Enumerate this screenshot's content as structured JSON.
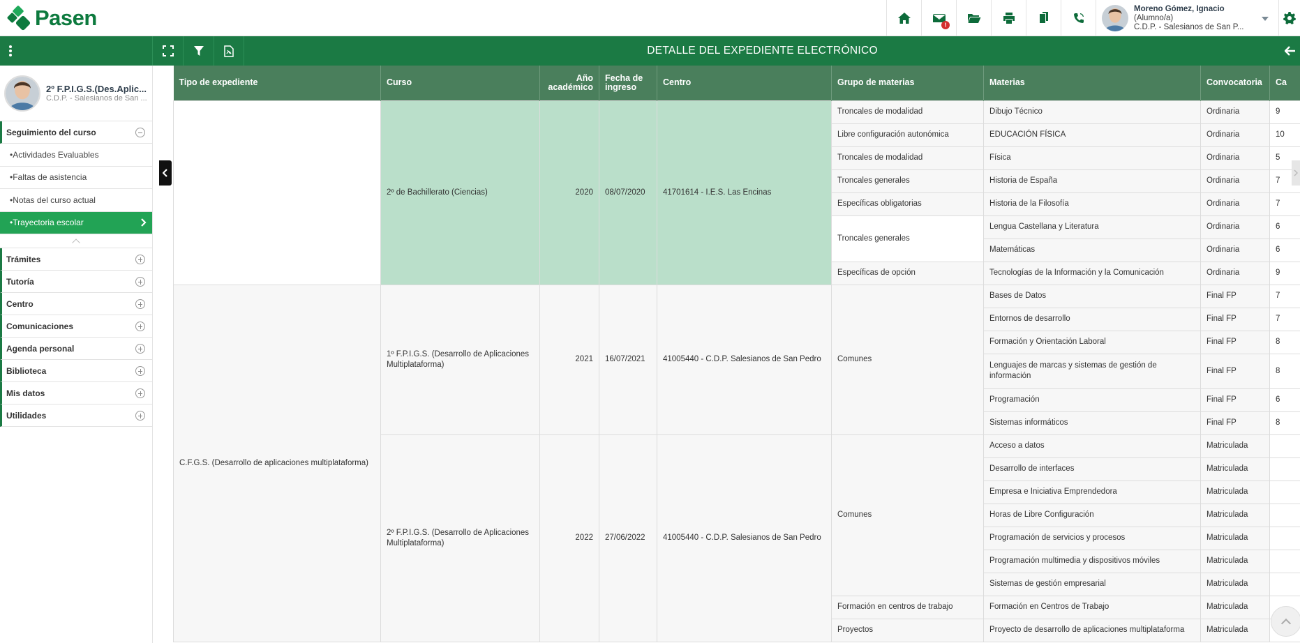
{
  "app": {
    "name": "Pasen"
  },
  "user": {
    "name": "Moreno Gómez, Ignacio",
    "role": "(Alumno/a)",
    "school": "C.D.P. - Salesianos de San P..."
  },
  "toolbar": {
    "icons": [
      "home-icon",
      "mail-icon",
      "folder-open-icon",
      "print-icon",
      "copy-icon",
      "phone-icon"
    ],
    "mail_badge": "!"
  },
  "greenbar": {
    "title": "DETALLE DEL EXPEDIENTE ELECTRÓNICO"
  },
  "profile": {
    "title": "2º F.P.I.G.S.(Des.Aplic...",
    "subtitle": "C.D.P. - Salesianos de San ..."
  },
  "sidebar": {
    "section_open": "Seguimiento del curso",
    "sub_items": [
      "•Actividades Evaluables",
      "•Faltas de asistencia",
      "•Notas del curso actual",
      "•Trayectoria escolar"
    ],
    "sections": [
      "Trámites",
      "Tutoría",
      "Centro",
      "Comunicaciones",
      "Agenda personal",
      "Biblioteca",
      "Mis datos",
      "Utilidades"
    ]
  },
  "table": {
    "headers": [
      "Tipo de expediente",
      "Curso",
      "Año académico",
      "Fecha de ingreso",
      "Centro",
      "Grupo de materias",
      "Materias",
      "Convocatoria",
      "Ca"
    ],
    "tipo2": "C.F.G.S. (Desarrollo de aplicaciones multiplataforma)",
    "block1": {
      "curso": "2º de Bachillerato (Ciencias)",
      "anio": "2020",
      "fecha": "08/07/2020",
      "centro": "41701614 - I.E.S. Las Encinas",
      "rows": [
        {
          "grupo": "Troncales de modalidad",
          "materia": "Dibujo Técnico",
          "conv": "Ordinaria",
          "cal": "9"
        },
        {
          "grupo": "Libre configuración autonómica",
          "materia": "EDUCACIÓN FÍSICA",
          "conv": "Ordinaria",
          "cal": "10"
        },
        {
          "grupo": "Troncales de modalidad",
          "materia": "Física",
          "conv": "Ordinaria",
          "cal": "5"
        },
        {
          "grupo": "Troncales generales",
          "materia": "Historia de España",
          "conv": "Ordinaria",
          "cal": "7"
        },
        {
          "grupo": "Específicas obligatorias",
          "materia": "Historia de la Filosofía",
          "conv": "Ordinaria",
          "cal": "7"
        },
        {
          "grupo": "Troncales generales",
          "materia": "Lengua Castellana y Literatura",
          "conv": "Ordinaria",
          "cal": "6"
        },
        {
          "grupo": "",
          "materia": "Matemáticas",
          "conv": "Ordinaria",
          "cal": "6"
        },
        {
          "grupo": "Específicas de opción",
          "materia": "Tecnologías de la Información y la Comunicación",
          "conv": "Ordinaria",
          "cal": "9"
        }
      ]
    },
    "block2": {
      "curso": "1º F.P.I.G.S. (Desarrollo de Aplicaciones Multiplataforma)",
      "anio": "2021",
      "fecha": "16/07/2021",
      "centro": "41005440 - C.D.P. Salesianos de San Pedro",
      "grupo": "Comunes",
      "rows": [
        {
          "materia": "Bases de Datos",
          "conv": "Final FP",
          "cal": "7"
        },
        {
          "materia": "Entornos de desarrollo",
          "conv": "Final FP",
          "cal": "7"
        },
        {
          "materia": "Formación y Orientación Laboral",
          "conv": "Final FP",
          "cal": "8"
        },
        {
          "materia": "Lenguajes de marcas y sistemas de gestión de información",
          "conv": "Final FP",
          "cal": "8"
        },
        {
          "materia": "Programación",
          "conv": "Final FP",
          "cal": "6"
        },
        {
          "materia": "Sistemas informáticos",
          "conv": "Final FP",
          "cal": "8"
        }
      ]
    },
    "block3": {
      "curso": "2º F.P.I.G.S. (Desarrollo de Aplicaciones Multiplataforma)",
      "anio": "2022",
      "fecha": "27/06/2022",
      "centro": "41005440 - C.D.P. Salesianos de San Pedro",
      "grupo": "Comunes",
      "rows": [
        {
          "materia": "Acceso a datos",
          "conv": "Matriculada"
        },
        {
          "materia": "Desarrollo de interfaces",
          "conv": "Matriculada"
        },
        {
          "materia": "Empresa e Iniciativa Emprendedora",
          "conv": "Matriculada"
        },
        {
          "materia": "Horas de Libre Configuración",
          "conv": "Matriculada"
        },
        {
          "materia": "Programación de servicios y procesos",
          "conv": "Matriculada"
        },
        {
          "materia": "Programación multimedia y dispositivos móviles",
          "conv": "Matriculada"
        },
        {
          "materia": "Sistemas de gestión empresarial",
          "conv": "Matriculada"
        }
      ],
      "fct": {
        "grupo": "Formación en centros de trabajo",
        "materia": "Formación en Centros de Trabajo",
        "conv": "Matriculada"
      },
      "proy": {
        "grupo": "Proyectos",
        "materia": "Proyecto de desarrollo de aplicaciones multiplataforma",
        "conv": "Matriculada"
      }
    }
  }
}
